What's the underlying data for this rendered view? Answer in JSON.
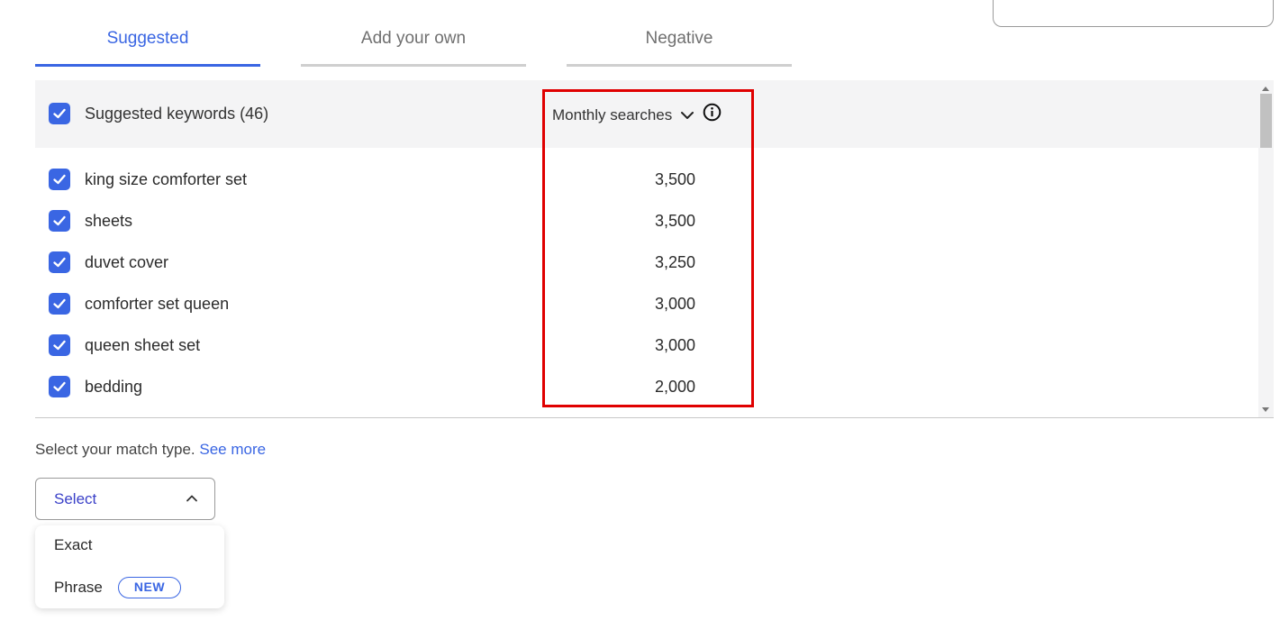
{
  "tabs": [
    {
      "label": "Suggested",
      "active": true
    },
    {
      "label": "Add your own",
      "active": false
    },
    {
      "label": "Negative",
      "active": false
    }
  ],
  "table": {
    "header_label": "Suggested keywords (46)",
    "sort_column": "Monthly searches",
    "rows": [
      {
        "keyword": "king size comforter set",
        "monthly_searches": "3,500",
        "checked": true
      },
      {
        "keyword": "sheets",
        "monthly_searches": "3,500",
        "checked": true
      },
      {
        "keyword": "duvet cover",
        "monthly_searches": "3,250",
        "checked": true
      },
      {
        "keyword": "comforter set queen",
        "monthly_searches": "3,000",
        "checked": true
      },
      {
        "keyword": "queen sheet set",
        "monthly_searches": "3,000",
        "checked": true
      },
      {
        "keyword": "bedding",
        "monthly_searches": "2,000",
        "checked": true
      }
    ]
  },
  "match_type": {
    "prompt": "Select your match type.",
    "see_more": "See more",
    "select_label": "Select",
    "options": [
      {
        "label": "Exact"
      },
      {
        "label": "Phrase",
        "badge": "NEW"
      }
    ]
  },
  "colors": {
    "accent": "#3a66e3",
    "highlight": "#e00000"
  }
}
